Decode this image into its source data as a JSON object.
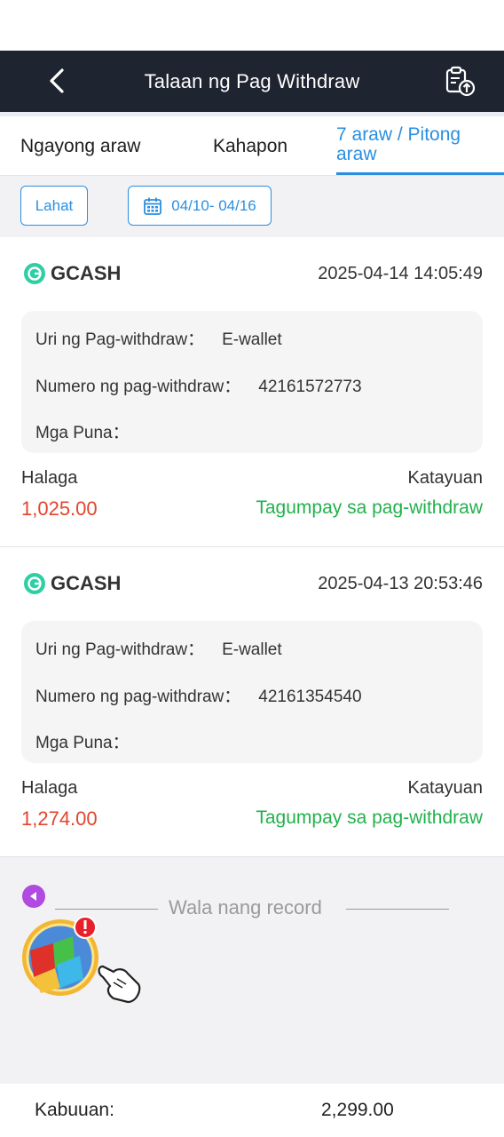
{
  "header": {
    "title": "Talaan ng Pag Withdraw",
    "back_icon": "chevron-left-icon",
    "export_icon": "clipboard-upload-icon"
  },
  "tabs": [
    {
      "label": "Ngayong araw",
      "active": false
    },
    {
      "label": "Kahapon",
      "active": false
    },
    {
      "label": "7 araw / Pitong araw",
      "active": true
    }
  ],
  "filters": {
    "all_label": "Lahat",
    "date_range": "04/10- 04/16",
    "date_icon": "calendar-icon"
  },
  "labels": {
    "type": "Uri ng Pag-withdraw：",
    "number": "Numero ng pag-withdraw：",
    "remarks": "Mga Puna：",
    "amount": "Halaga",
    "status": "Katayuan"
  },
  "records": [
    {
      "method": "GCASH",
      "datetime": "2025-04-14 14:05:49",
      "type_value": "E-wallet",
      "number_value": "42161572773",
      "remarks_value": "",
      "amount": "1,025.00",
      "status": "Tagumpay sa pag-withdraw"
    },
    {
      "method": "GCASH",
      "datetime": "2025-04-13 20:53:46",
      "type_value": "E-wallet",
      "number_value": "42161354540",
      "remarks_value": "",
      "amount": "1,274.00",
      "status": "Tagumpay sa pag-withdraw"
    }
  ],
  "empty": {
    "text": "Wala nang record"
  },
  "footer": {
    "total_label": "Kabuuan:",
    "total_value": "2,299.00"
  },
  "colors": {
    "header_bg": "#1f2431",
    "accent_blue": "#2b8fe0",
    "amount_red": "#e2452e",
    "status_green": "#22b14c",
    "gcash_teal": "#2fcfa6"
  }
}
